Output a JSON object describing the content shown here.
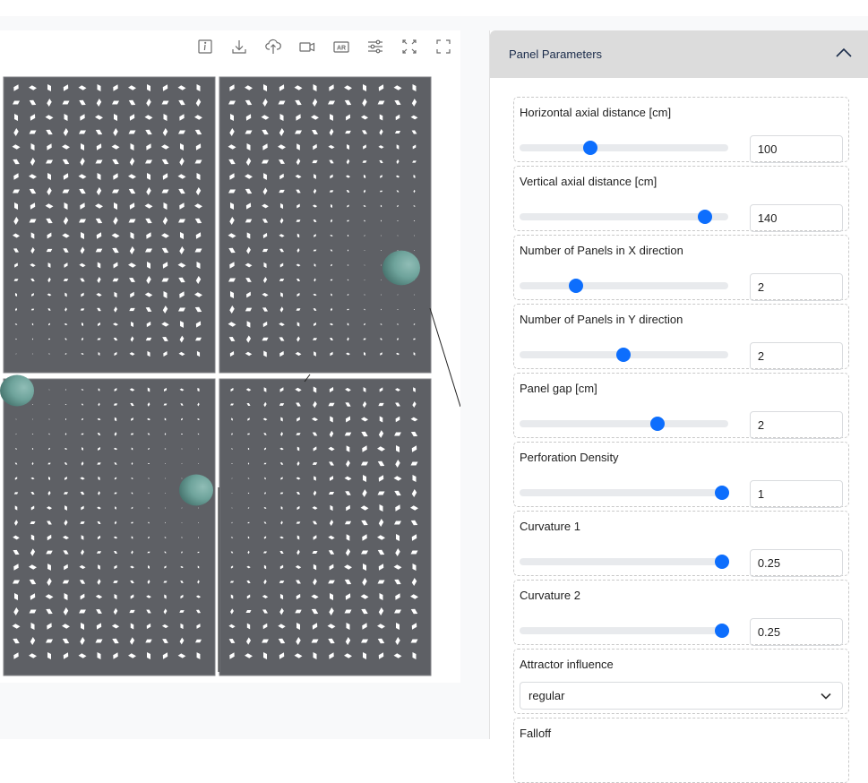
{
  "toolbar": {
    "buttons": [
      {
        "name": "info-button",
        "icon": "info-icon"
      },
      {
        "name": "download-button",
        "icon": "download-icon"
      },
      {
        "name": "upload-cloud-button",
        "icon": "cloud-upload-icon"
      },
      {
        "name": "video-button",
        "icon": "video-camera-icon"
      },
      {
        "name": "ar-button",
        "icon": "ar-icon",
        "text": "AR"
      },
      {
        "name": "settings-button",
        "icon": "sliders-icon"
      },
      {
        "name": "zoom-extents-button",
        "icon": "arrows-expand-icon"
      },
      {
        "name": "fullscreen-button",
        "icon": "fullscreen-icon"
      }
    ]
  },
  "viewer": {
    "panel_color": "#5e6065",
    "sphere_color": "#6ea39b",
    "panels": [
      "top-left",
      "top-right",
      "bottom-left",
      "bottom-right"
    ],
    "attractors": 3
  },
  "sidebar": {
    "section_title": "Panel Parameters",
    "accent": "#0d6efd",
    "params": [
      {
        "label": "Horizontal axial distance [cm]",
        "value": "100",
        "fraction": 0.34
      },
      {
        "label": "Vertical axial distance [cm]",
        "value": "140",
        "fraction": 0.89
      },
      {
        "label": "Number of Panels in X direction",
        "value": "2",
        "fraction": 0.27
      },
      {
        "label": "Number of Panels in Y direction",
        "value": "2",
        "fraction": 0.5
      },
      {
        "label": "Panel gap [cm]",
        "value": "2",
        "fraction": 0.66
      },
      {
        "label": "Perforation Density",
        "value": "1",
        "fraction": 0.97
      },
      {
        "label": "Curvature 1",
        "value": "0.25",
        "fraction": 0.97
      },
      {
        "label": "Curvature 2",
        "value": "0.25",
        "fraction": 0.97
      }
    ],
    "attractor_influence": {
      "label": "Attractor influence",
      "value": "regular"
    },
    "falloff": {
      "label": "Falloff"
    }
  }
}
